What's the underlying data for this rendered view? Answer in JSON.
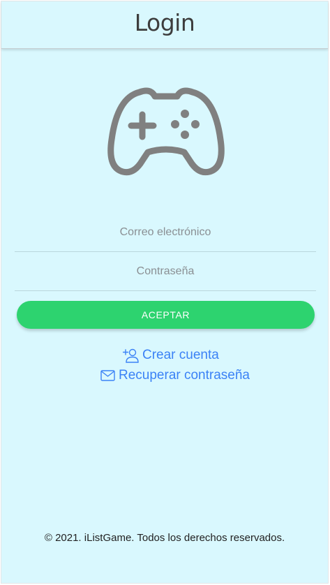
{
  "header": {
    "title": "Login"
  },
  "logo": {
    "icon": "gamepad-icon",
    "color": "#808080"
  },
  "form": {
    "email_placeholder": "Correo electrónico",
    "password_placeholder": "Contraseña",
    "submit_label": "ACEPTAR"
  },
  "links": {
    "create_account": {
      "label": "Crear cuenta",
      "icon": "add-user-icon"
    },
    "recover_password": {
      "label": "Recuperar contraseña",
      "icon": "mail-icon"
    }
  },
  "footer": {
    "text": "© 2021. iListGame. Todos los derechos reservados."
  },
  "colors": {
    "background": "#d9f8fe",
    "accent": "#2dd36f",
    "link": "#3b82f6"
  }
}
